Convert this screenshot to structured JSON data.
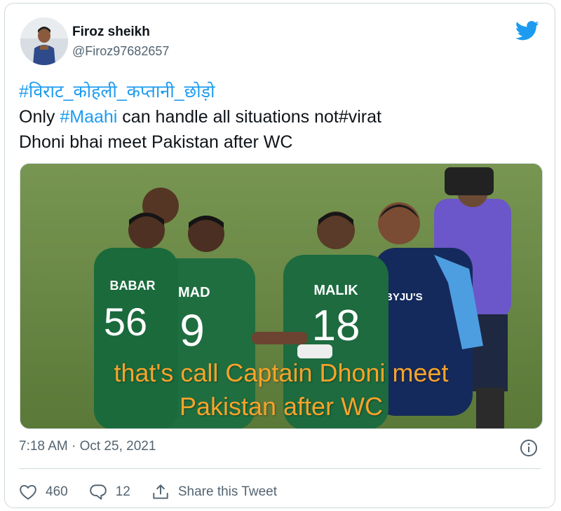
{
  "author": {
    "display_name": "Firoz sheikh",
    "handle": "@Firoz97682657"
  },
  "tweet": {
    "hashtag_line": "#विराट_कोहली_कप्तानी_छोड़ो",
    "line2_prefix": "Only ",
    "line2_hashtag": "#Maahi",
    "line2_suffix": " can handle all situations not#virat",
    "line3": "Dhoni bhai meet Pakistan after WC"
  },
  "media": {
    "caption_line1": "that's call Captain Dhoni meet",
    "caption_line2": "Pakistan after WC",
    "jersey_names": [
      "BABAR",
      "IMAD",
      "MALIK",
      "BYJU'S"
    ],
    "jersey_numbers": [
      "56",
      "9",
      "18"
    ]
  },
  "timestamp": "7:18 AM · Oct 25, 2021",
  "actions": {
    "likes": "460",
    "replies": "12",
    "share_label": "Share this Tweet"
  },
  "colors": {
    "link": "#1d9bf0",
    "caption": "#f7a32a",
    "pitch": "#6f8f47"
  },
  "icons": [
    "twitter-bird-icon",
    "info-icon",
    "heart-icon",
    "reply-icon",
    "share-icon"
  ]
}
